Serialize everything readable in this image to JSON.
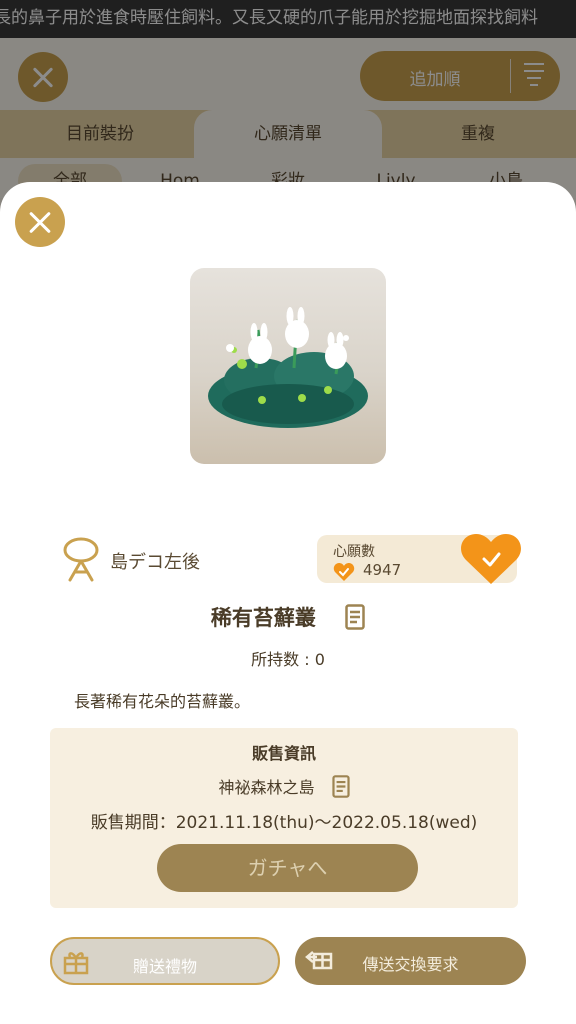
{
  "ticker": {
    "text": "長的鼻子用於進食時壓住飼料。又長又硬的爪子能用於挖掘地面探找飼料"
  },
  "header": {
    "sort_label": "追加順",
    "sort_icon": "sort-icon",
    "close_icon": "close-icon"
  },
  "tabs": [
    {
      "label": "目前裝扮"
    },
    {
      "label": "心願清單"
    },
    {
      "label": "重複"
    }
  ],
  "subtabs": [
    {
      "label": "全部"
    },
    {
      "label": "Hom"
    },
    {
      "label": "彩妝"
    },
    {
      "label": "Livly"
    },
    {
      "label": "小島"
    }
  ],
  "modal": {
    "close_icon": "close-icon",
    "item_image": "rare-moss-clump-image",
    "category_icon": "island-deco-icon",
    "category": "島デコ左後",
    "wish": {
      "label": "心願數",
      "count": "4947",
      "heart_icon": "heart-check-icon"
    },
    "title": "稀有苔蘚叢",
    "owned": "所持数 : 0",
    "description": "長著稀有花朵的苔蘚叢。",
    "sale": {
      "title": "販售資訊",
      "place": "神祕森林之島",
      "period": "販售期間：2021.11.18(thu)〜2022.05.18(wed)",
      "gacha_label": "ガチャへ"
    },
    "gift_label": "贈送禮物",
    "trade_label": "傳送交換要求"
  },
  "colors": {
    "gold": "#c9a14f",
    "brown_button": "#9d8452",
    "text_dark": "#4a3c28",
    "heart_orange": "#f39419"
  }
}
